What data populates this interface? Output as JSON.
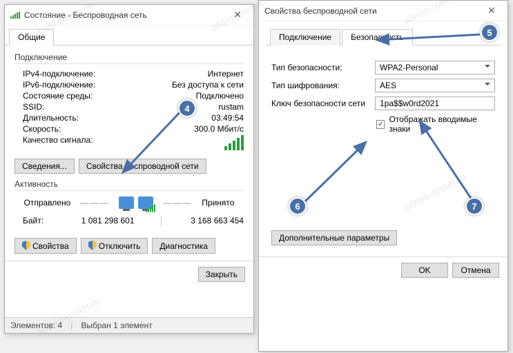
{
  "status_window": {
    "title": "Состояние - Беспроводная сеть",
    "tabs": {
      "general": "Общие"
    },
    "group_connection": "Подключение",
    "fields": {
      "ipv4_label": "IPv4-подключение:",
      "ipv4_value": "Интернет",
      "ipv6_label": "IPv6-подключение:",
      "ipv6_value": "Без доступа к сети",
      "media_label": "Состояние среды:",
      "media_value": "Подключено",
      "ssid_label": "SSID:",
      "ssid_value": "rustam",
      "duration_label": "Длительность:",
      "duration_value": "03:49:54",
      "speed_label": "Скорость:",
      "speed_value": "300.0 Мбит/с",
      "signal_label": "Качество сигнала:"
    },
    "buttons": {
      "details": "Сведения...",
      "wifi_props": "Свойства беспроводной сети"
    },
    "group_activity": "Активность",
    "activity": {
      "sent_label": "Отправлено",
      "recv_label": "Принято",
      "bytes_label": "Байт:",
      "sent": "1 081 298 601",
      "recv": "3 168 663 454"
    },
    "bottom": {
      "properties": "Свойства",
      "disable": "Отключить",
      "diagnose": "Диагностика"
    },
    "close": "Закрыть",
    "statusbar": {
      "elements": "Элементов: 4",
      "selected": "Выбран 1 элемент"
    }
  },
  "props_window": {
    "title": "Свойства беспроводной сети",
    "tabs": {
      "connection": "Подключение",
      "security": "Безопасность"
    },
    "security_type_label": "Тип безопасности:",
    "security_type_value": "WPA2-Personal",
    "encryption_label": "Тип шифрования:",
    "encryption_value": "AES",
    "key_label": "Ключ безопасности сети",
    "key_value": "1pa$$w0rd2021",
    "show_chars": "Отображать вводимые знаки",
    "advanced": "Дополнительные параметры",
    "ok": "OK",
    "cancel": "Отмена"
  },
  "annotations": {
    "b4": "4",
    "b5": "5",
    "b6": "6",
    "b7": "7"
  },
  "watermark": "admin-router.ru"
}
